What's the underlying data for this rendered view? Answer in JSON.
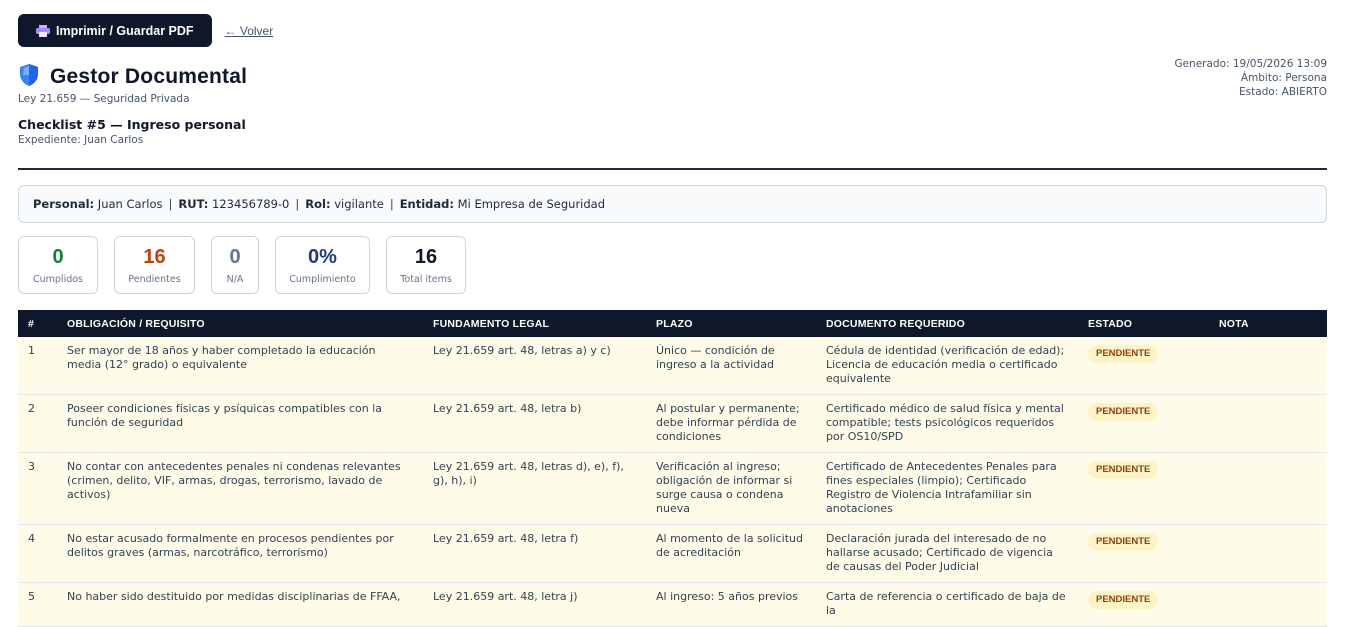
{
  "toolbar": {
    "print_label": "Imprimir / Guardar PDF",
    "back_label": "← Volver"
  },
  "header": {
    "title": "Gestor Documental",
    "subtitle": "Ley 21.659 — Seguridad Privada",
    "checklist": "Checklist #5 — Ingreso personal",
    "expediente": "Expediente: Juan Carlos",
    "meta": {
      "generado": "Generado: 19/05/2026 13:09",
      "ambito": "Ámbito: Persona",
      "estado": "Estado: ABIERTO"
    }
  },
  "info": {
    "personal_label": "Personal:",
    "personal_value": "Juan Carlos",
    "rut_label": "RUT:",
    "rut_value": "123456789-0",
    "rol_label": "Rol:",
    "rol_value": "vigilante",
    "entidad_label": "Entidad:",
    "entidad_value": "Mi Empresa de Seguridad",
    "separator": "|"
  },
  "stats": [
    {
      "value": "0",
      "label": "Cumplidos",
      "color": "#15803d"
    },
    {
      "value": "16",
      "label": "Pendientes",
      "color": "#c2410c"
    },
    {
      "value": "0",
      "label": "N/A",
      "color": "#64748b"
    },
    {
      "value": "0%",
      "label": "Cumplimiento",
      "color": "#1e3a8a"
    },
    {
      "value": "16",
      "label": "Total items",
      "color": "#0f172a"
    }
  ],
  "table": {
    "headers": [
      "#",
      "OBLIGACIÓN / REQUISITO",
      "FUNDAMENTO LEGAL",
      "PLAZO",
      "DOCUMENTO REQUERIDO",
      "ESTADO",
      "NOTA"
    ],
    "rows": [
      {
        "n": "1",
        "obligacion": "Ser mayor de 18 años y haber completado la educación media (12° grado) o equivalente",
        "fundamento": "Ley 21.659 art. 48, letras a) y c)",
        "plazo": "Único — condición de ingreso a la actividad",
        "documento": "Cédula de identidad (verificación de edad); Licencia de educación media o certificado equivalente",
        "estado": "PENDIENTE",
        "nota": ""
      },
      {
        "n": "2",
        "obligacion": "Poseer condiciones físicas y psíquicas compatibles con la función de seguridad",
        "fundamento": "Ley 21.659 art. 48, letra b)",
        "plazo": "Al postular y permanente; debe informar pérdida de condiciones",
        "documento": "Certificado médico de salud física y mental compatible; tests psicológicos requeridos por OS10/SPD",
        "estado": "PENDIENTE",
        "nota": ""
      },
      {
        "n": "3",
        "obligacion": "No contar con antecedentes penales ni condenas relevantes (crimen, delito, VIF, armas, drogas, terrorismo, lavado de activos)",
        "fundamento": "Ley 21.659 art. 48, letras d), e), f), g), h), i)",
        "plazo": "Verificación al ingreso; obligación de informar si surge causa o condena nueva",
        "documento": "Certificado de Antecedentes Penales para fines especiales (limpio); Certificado Registro de Violencia Intrafamiliar sin anotaciones",
        "estado": "PENDIENTE",
        "nota": ""
      },
      {
        "n": "4",
        "obligacion": "No estar acusado formalmente en procesos pendientes por delitos graves (armas, narcotráfico, terrorismo)",
        "fundamento": "Ley 21.659 art. 48, letra f)",
        "plazo": "Al momento de la solicitud de acreditación",
        "documento": "Declaración jurada del interesado de no hallarse acusado; Certificado de vigencia de causas del Poder Judicial",
        "estado": "PENDIENTE",
        "nota": ""
      },
      {
        "n": "5",
        "obligacion": "No haber sido destituido por medidas disciplinarias de FFAA,",
        "fundamento": "Ley 21.659 art. 48, letra j)",
        "plazo": "Al ingreso: 5 años previos",
        "documento": "Carta de referencia o certificado de baja de la",
        "estado": "PENDIENTE",
        "nota": ""
      }
    ]
  }
}
